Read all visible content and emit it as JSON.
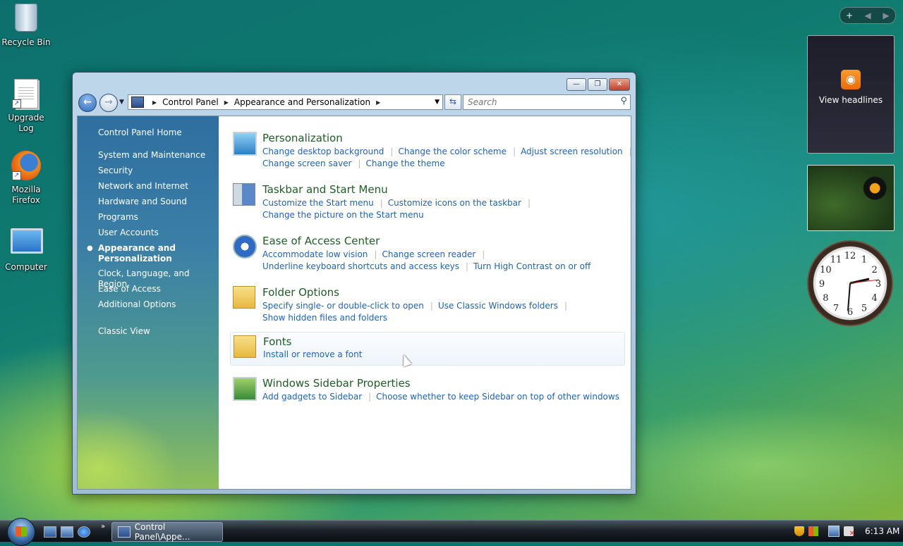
{
  "desktop": {
    "icons": [
      {
        "label": "Recycle Bin",
        "icon": "recycle-bin-icon"
      },
      {
        "label": "Upgrade Log",
        "icon": "document-shortcut-icon"
      },
      {
        "label": "Mozilla Firefox",
        "icon": "firefox-icon"
      },
      {
        "label": "Computer",
        "icon": "computer-icon"
      }
    ]
  },
  "sidebar_gadgets": {
    "controls": [
      "+",
      "◀",
      "▶"
    ],
    "feed_label": "View headlines",
    "clock_numbers": [
      "12",
      "1",
      "2",
      "3",
      "4",
      "5",
      "6",
      "7",
      "8",
      "9",
      "10",
      "11"
    ]
  },
  "window": {
    "buttons": {
      "minimize": "—",
      "maximize": "❐",
      "close": "✕"
    },
    "address": {
      "crumbs": [
        "Control Panel",
        "Appearance and Personalization"
      ]
    },
    "search_placeholder": "Search",
    "left_nav": {
      "home": "Control Panel Home",
      "items": [
        "System and Maintenance",
        "Security",
        "Network and Internet",
        "Hardware and Sound",
        "Programs",
        "User Accounts",
        "Appearance and Personalization",
        "Clock, Language, and Region",
        "Ease of Access",
        "Additional Options"
      ],
      "active_index": 6,
      "classic_view": "Classic View"
    },
    "categories": [
      {
        "title": "Personalization",
        "icon": "personalization-icon",
        "links": [
          "Change desktop background",
          "Change the color scheme",
          "Adjust screen resolution",
          "Change screen saver",
          "Change the theme"
        ]
      },
      {
        "title": "Taskbar and Start Menu",
        "icon": "taskbar-icon",
        "links": [
          "Customize the Start menu",
          "Customize icons on the taskbar",
          "Change the picture on the Start menu"
        ]
      },
      {
        "title": "Ease of Access Center",
        "icon": "ease-of-access-icon",
        "links": [
          "Accommodate low vision",
          "Change screen reader",
          "Underline keyboard shortcuts and access keys",
          "Turn High Contrast on or off"
        ]
      },
      {
        "title": "Folder Options",
        "icon": "folder-options-icon",
        "links": [
          "Specify single- or double-click to open",
          "Use Classic Windows folders",
          "Show hidden files and folders"
        ]
      },
      {
        "title": "Fonts",
        "icon": "fonts-icon",
        "links": [
          "Install or remove a font"
        ]
      },
      {
        "title": "Windows Sidebar Properties",
        "icon": "sidebar-icon",
        "links": [
          "Add gadgets to Sidebar",
          "Choose whether to keep Sidebar on top of other windows"
        ]
      }
    ]
  },
  "taskbar": {
    "more": "»",
    "task_label": "Control Panel\\Appe...",
    "time": "6:13 AM"
  }
}
